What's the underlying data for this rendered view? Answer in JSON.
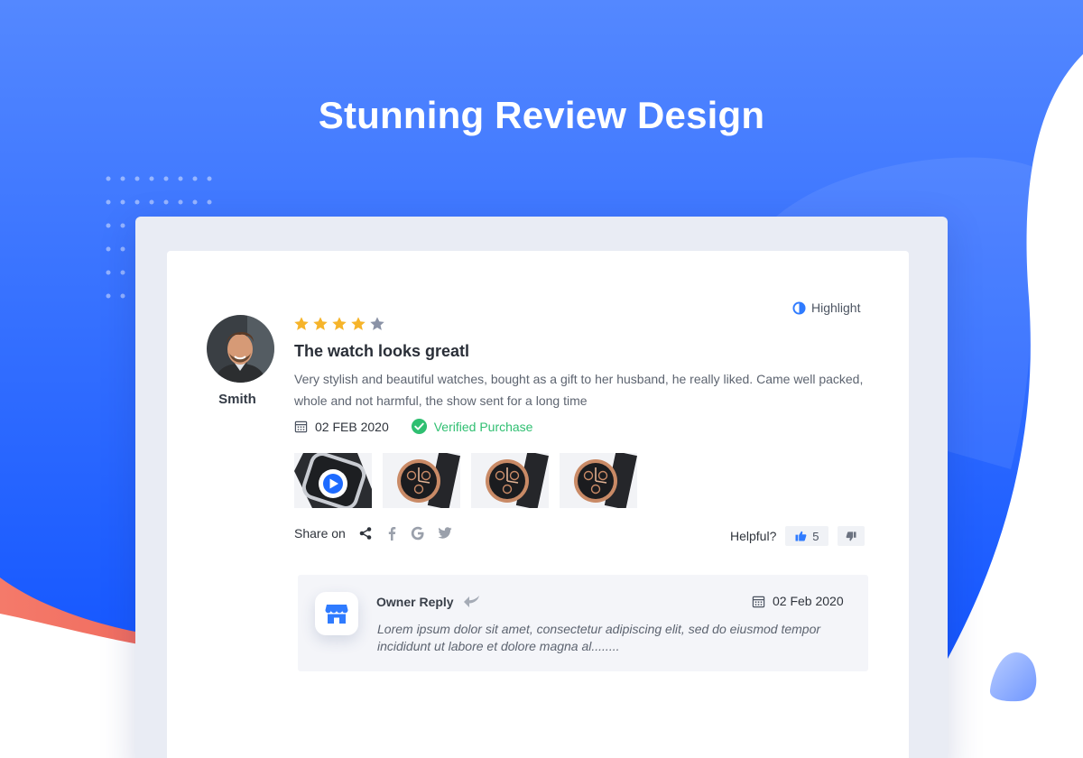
{
  "hero": {
    "title": "Stunning Review Design"
  },
  "colors": {
    "background_blue": "#2f6bff",
    "accent_coral": "#f47a6a",
    "star_filled": "#f6b42a",
    "star_empty": "#8a92a6",
    "verified_green": "#2fbf71",
    "brand_blue": "#2f7bff"
  },
  "review": {
    "reviewer": {
      "name": "Smith",
      "avatar_icon": "person-avatar"
    },
    "highlight_label": "Highlight",
    "rating": {
      "value": 4,
      "max": 5
    },
    "title": "The watch looks greatl",
    "body": "Very stylish and beautiful watches, bought as a gift to her husband, he really liked. Came well packed, whole and not harmful, the show sent for a long time",
    "date": "02 FEB 2020",
    "verified_label": "Verified Purchase",
    "media": [
      {
        "type": "video",
        "icon": "smartwatch-video"
      },
      {
        "type": "image",
        "icon": "wristwatch"
      },
      {
        "type": "image",
        "icon": "wristwatch"
      },
      {
        "type": "image",
        "icon": "wristwatch"
      }
    ],
    "share": {
      "label": "Share on",
      "icons": [
        "share-icon",
        "facebook-icon",
        "google-icon",
        "twitter-icon"
      ]
    },
    "helpful": {
      "label": "Helpful?",
      "up_count": "5"
    }
  },
  "reply": {
    "title": "Owner Reply",
    "date": "02 Feb 2020",
    "text": "Lorem ipsum dolor sit amet, consectetur adipiscing elit, sed do eiusmod tempor incididunt ut labore et dolore magna al........"
  }
}
